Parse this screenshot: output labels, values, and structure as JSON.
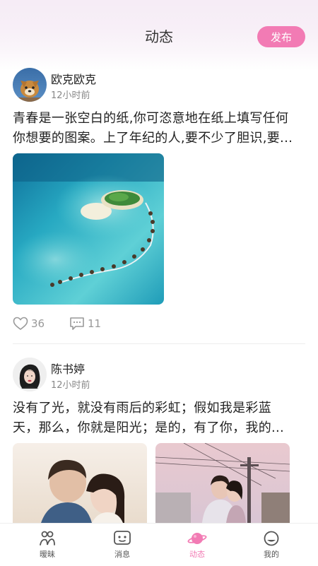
{
  "header": {
    "title": "动态",
    "publish_label": "发布"
  },
  "posts": [
    {
      "username": "欧克欧克",
      "time": "12小时前",
      "content_lines": [
        "青春是一张空白的纸,你可恣意地在纸上填写任何",
        "你想要的图案。上了年纪的人,要不少了胆识,要..."
      ],
      "likes": "36",
      "comments": "11"
    },
    {
      "username": "陈书婷",
      "time": "12小时前",
      "content_lines": [
        "没有了光，就没有雨后的彩虹；假如我是彩蓝",
        "天，那么，你就是阳光；是的，有了你，我的..."
      ]
    }
  ],
  "tabbar": {
    "items": [
      {
        "label": "暧昧",
        "icon": "pair-icon"
      },
      {
        "label": "消息",
        "icon": "message-icon"
      },
      {
        "label": "动态",
        "icon": "planet-icon",
        "active": true
      },
      {
        "label": "我的",
        "icon": "profile-icon"
      }
    ]
  },
  "colors": {
    "accent": "#f27bb4"
  }
}
